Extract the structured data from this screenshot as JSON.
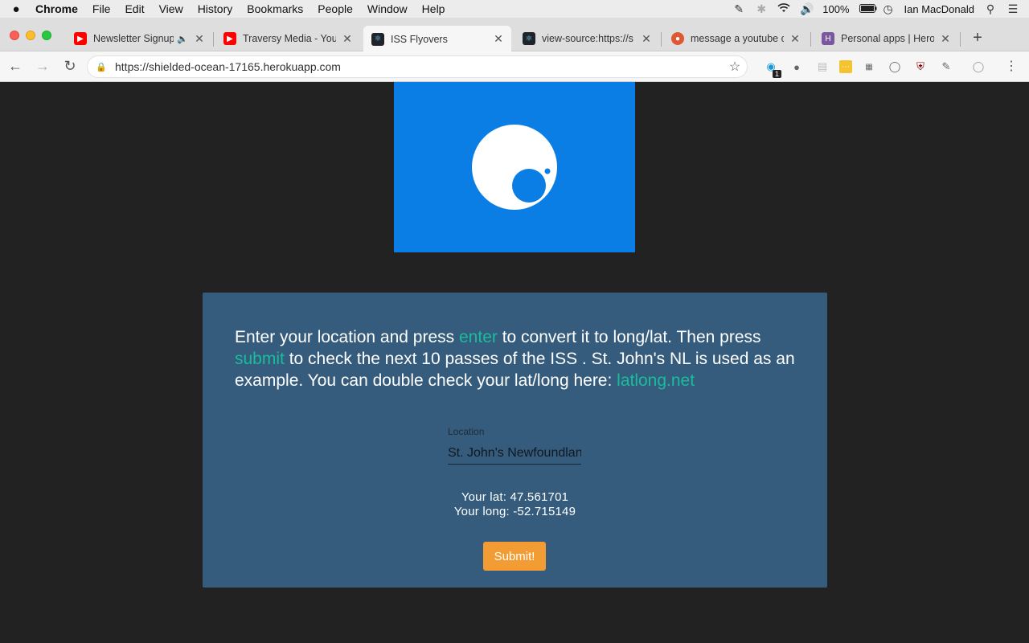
{
  "menubar": {
    "apple": "",
    "items": [
      "Chrome",
      "File",
      "Edit",
      "View",
      "History",
      "Bookmarks",
      "People",
      "Window",
      "Help"
    ],
    "battery": "100%",
    "user": "Ian MacDonald"
  },
  "tabs": [
    {
      "title": "Newsletter Signup",
      "favicon": "youtube-icon"
    },
    {
      "title": "Traversy Media - YouTube",
      "favicon": "youtube-icon"
    },
    {
      "title": "ISS Flyovers",
      "favicon": "react-icon"
    },
    {
      "title": "view-source:https://s",
      "favicon": "react-icon"
    },
    {
      "title": "message a youtube c",
      "favicon": "duckduckgo-icon"
    },
    {
      "title": "Personal apps | Heroku",
      "favicon": "heroku-icon"
    }
  ],
  "toolbar": {
    "url": "https://shielded-ocean-17165.herokuapp.com",
    "ext_badge": "1"
  },
  "main": {
    "intro_1": "Enter your location and press ",
    "intro_enter": "enter",
    "intro_2": " to convert it to long/lat. Then press ",
    "intro_submit": "submit",
    "intro_3": " to check the next 10 passes of the ISS . St. John's NL is used as an example. You can double check your lat/long here: ",
    "intro_link": "latlong.net",
    "location_label": "Location",
    "location_value": "St. John's Newfoundland",
    "lat_text": "Your lat: 47.561701",
    "long_text": "Your long: -52.715149",
    "submit_label": "Submit!"
  },
  "colors": {
    "logo_bg": "#0a7ee4",
    "panel_bg": "#355c7d",
    "highlight": "#1abc9c",
    "submit_bg": "#f39c34"
  }
}
